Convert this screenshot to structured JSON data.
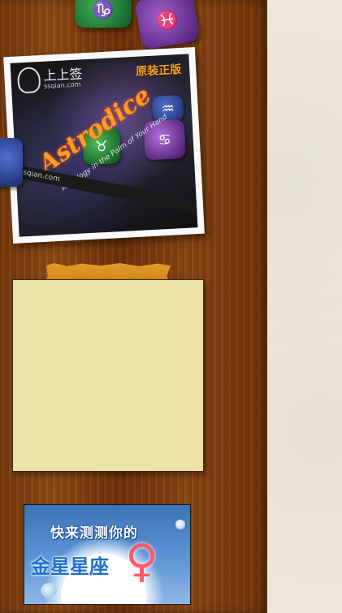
{
  "photo": {
    "logo_text": "上上签",
    "logo_url": "ssqian.com",
    "original_badge": "原装正版",
    "brand": "Astrodice",
    "brand_sub": "Astrology in the Palm of Your Hand",
    "watermark": "ssqian.com"
  },
  "note": {},
  "banner": {
    "line1": "快来测测你的",
    "line2": "金星星座",
    "symbol": "♀"
  },
  "colors": {
    "wood": "#7a3a0d",
    "paper": "#eee8dc",
    "note": "#ebe2a6",
    "tape": "#e8a22c",
    "banner_sky": "#3b73b8"
  }
}
